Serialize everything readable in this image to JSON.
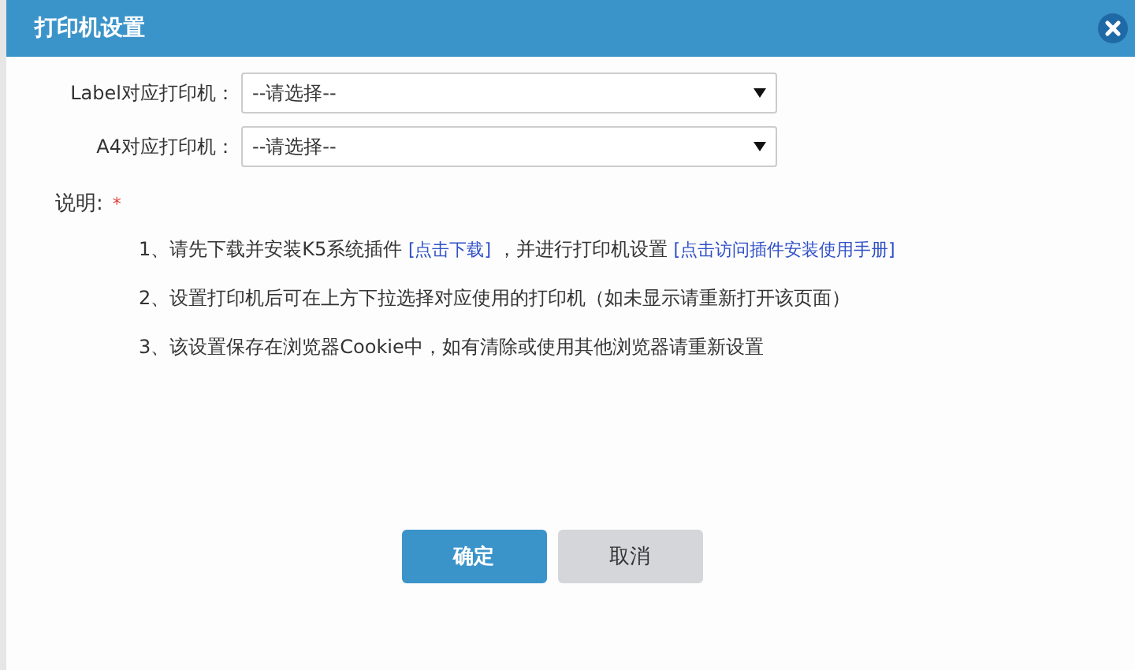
{
  "window": {
    "title": "打印机设置"
  },
  "fields": [
    {
      "label": "Label对应打印机：",
      "value": "--请选择--"
    },
    {
      "label": "A4对应打印机：",
      "value": "--请选择--"
    }
  ],
  "notes": {
    "label": "说明:",
    "required_mark": "*",
    "items": [
      [
        {
          "kind": "text",
          "text": "1、请先下载并安装K5系统插件 "
        },
        {
          "kind": "link",
          "text": "[点击下载]"
        },
        {
          "kind": "text",
          "text": " ，并进行打印机设置 "
        },
        {
          "kind": "link",
          "text": "[点击访问插件安装使用手册]"
        }
      ],
      [
        {
          "kind": "text",
          "text": "2、设置打印机后可在上方下拉选择对应使用的打印机（如未显示请重新打开该页面）"
        }
      ],
      [
        {
          "kind": "text",
          "text": "3、该设置保存在浏览器Cookie中，如有清除或使用其他浏览器请重新设置"
        }
      ]
    ]
  },
  "buttons": [
    {
      "label": "确定",
      "kind": "primary"
    },
    {
      "label": "取消",
      "kind": "secondary"
    }
  ]
}
